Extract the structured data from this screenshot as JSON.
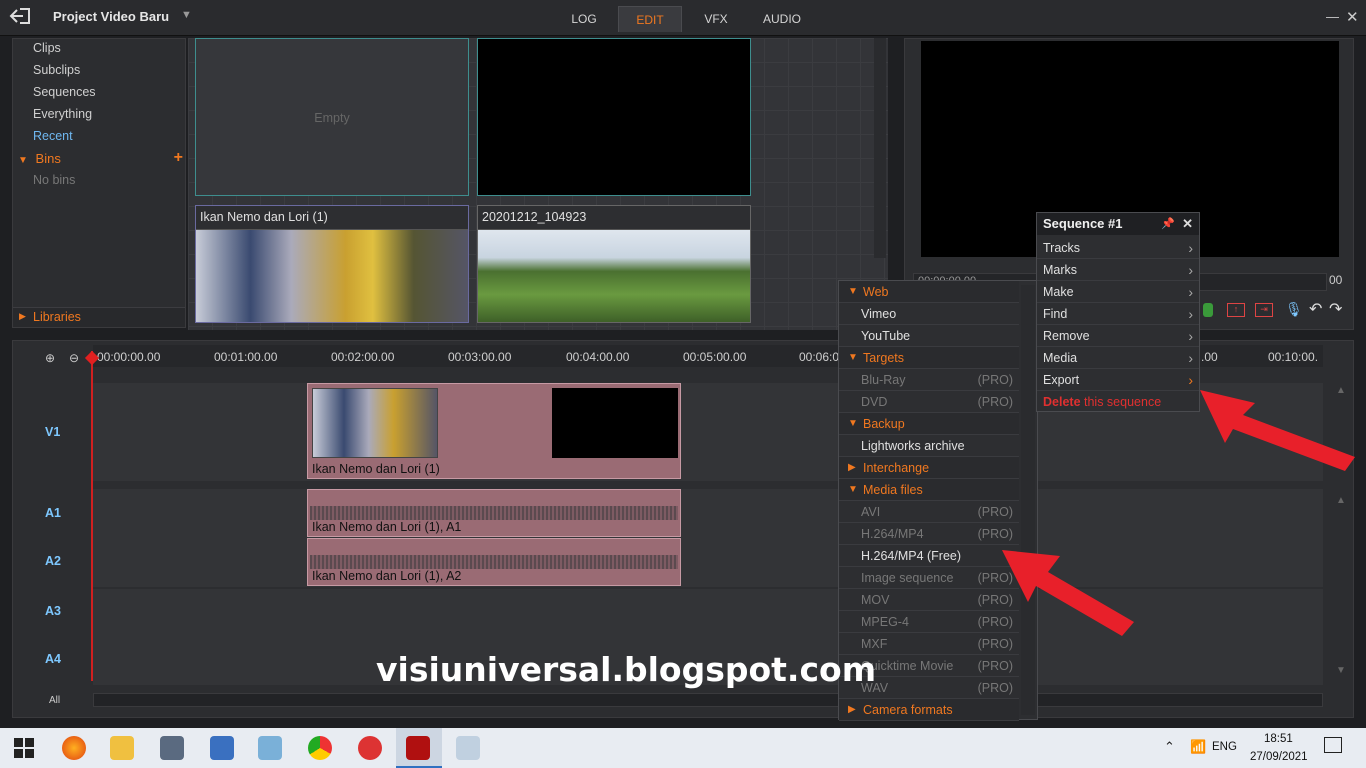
{
  "app": {
    "project_title": "Project Video Baru",
    "tabs": [
      "LOG",
      "EDIT",
      "VFX",
      "AUDIO"
    ],
    "active_tab": "EDIT"
  },
  "bins_panel": {
    "items": [
      "Clips",
      "Subclips",
      "Sequences",
      "Everything",
      "Recent"
    ],
    "bins_label": "Bins",
    "no_bins": "No bins",
    "libraries_label": "Libraries"
  },
  "thumbnails": {
    "empty_label": "Empty",
    "clip1_title": "Ikan Nemo dan Lori (1)",
    "clip2_title": "20201212_104923"
  },
  "viewer": {
    "timecode": "00:00:00.00",
    "counter": "00"
  },
  "timeline": {
    "ticks": [
      "00:00:00.00",
      "00:01:00.00",
      "00:02:00.00",
      "00:03:00.00",
      "00:04:00.00",
      "00:05:00.00",
      "00:06:0",
      ".00",
      "00:10:00."
    ],
    "tracks": [
      "V1",
      "A1",
      "A2",
      "A3",
      "A4"
    ],
    "all_label": "All",
    "video_clip_label": "Ikan Nemo dan Lori (1)",
    "a1_clip_label": "Ikan Nemo dan Lori (1), A1",
    "a2_clip_label": "Ikan Nemo dan Lori (1), A2"
  },
  "export_menu": {
    "web": "Web",
    "vimeo": "Vimeo",
    "youtube": "YouTube",
    "targets": "Targets",
    "bluray": "Blu-Ray",
    "dvd": "DVD",
    "backup": "Backup",
    "lw_archive": "Lightworks archive",
    "interchange": "Interchange",
    "media_files": "Media files",
    "avi": "AVI",
    "h264": "H.264/MP4",
    "h264_free": "H.264/MP4 (Free)",
    "image_seq": "Image sequence",
    "mov": "MOV",
    "mpeg4": "MPEG-4",
    "mxf": "MXF",
    "quicktime": "Quicktime Movie",
    "wav": "WAV",
    "camera_formats": "Camera formats",
    "pro": "(PRO)"
  },
  "sequence_menu": {
    "title": "Sequence #1",
    "items": [
      "Tracks",
      "Marks",
      "Make",
      "Find",
      "Remove",
      "Media",
      "Export"
    ],
    "delete_bold": "Delete",
    "delete_rest": " this sequence"
  },
  "watermark": "visiuniversal.blogspot.com",
  "taskbar": {
    "lang": "ENG",
    "time": "18:51",
    "date": "27/09/2021"
  },
  "colors": {
    "accent": "#f07820",
    "track_label": "#7ec8ff",
    "clip": "#9a6b74",
    "arrow": "#e8202a"
  }
}
